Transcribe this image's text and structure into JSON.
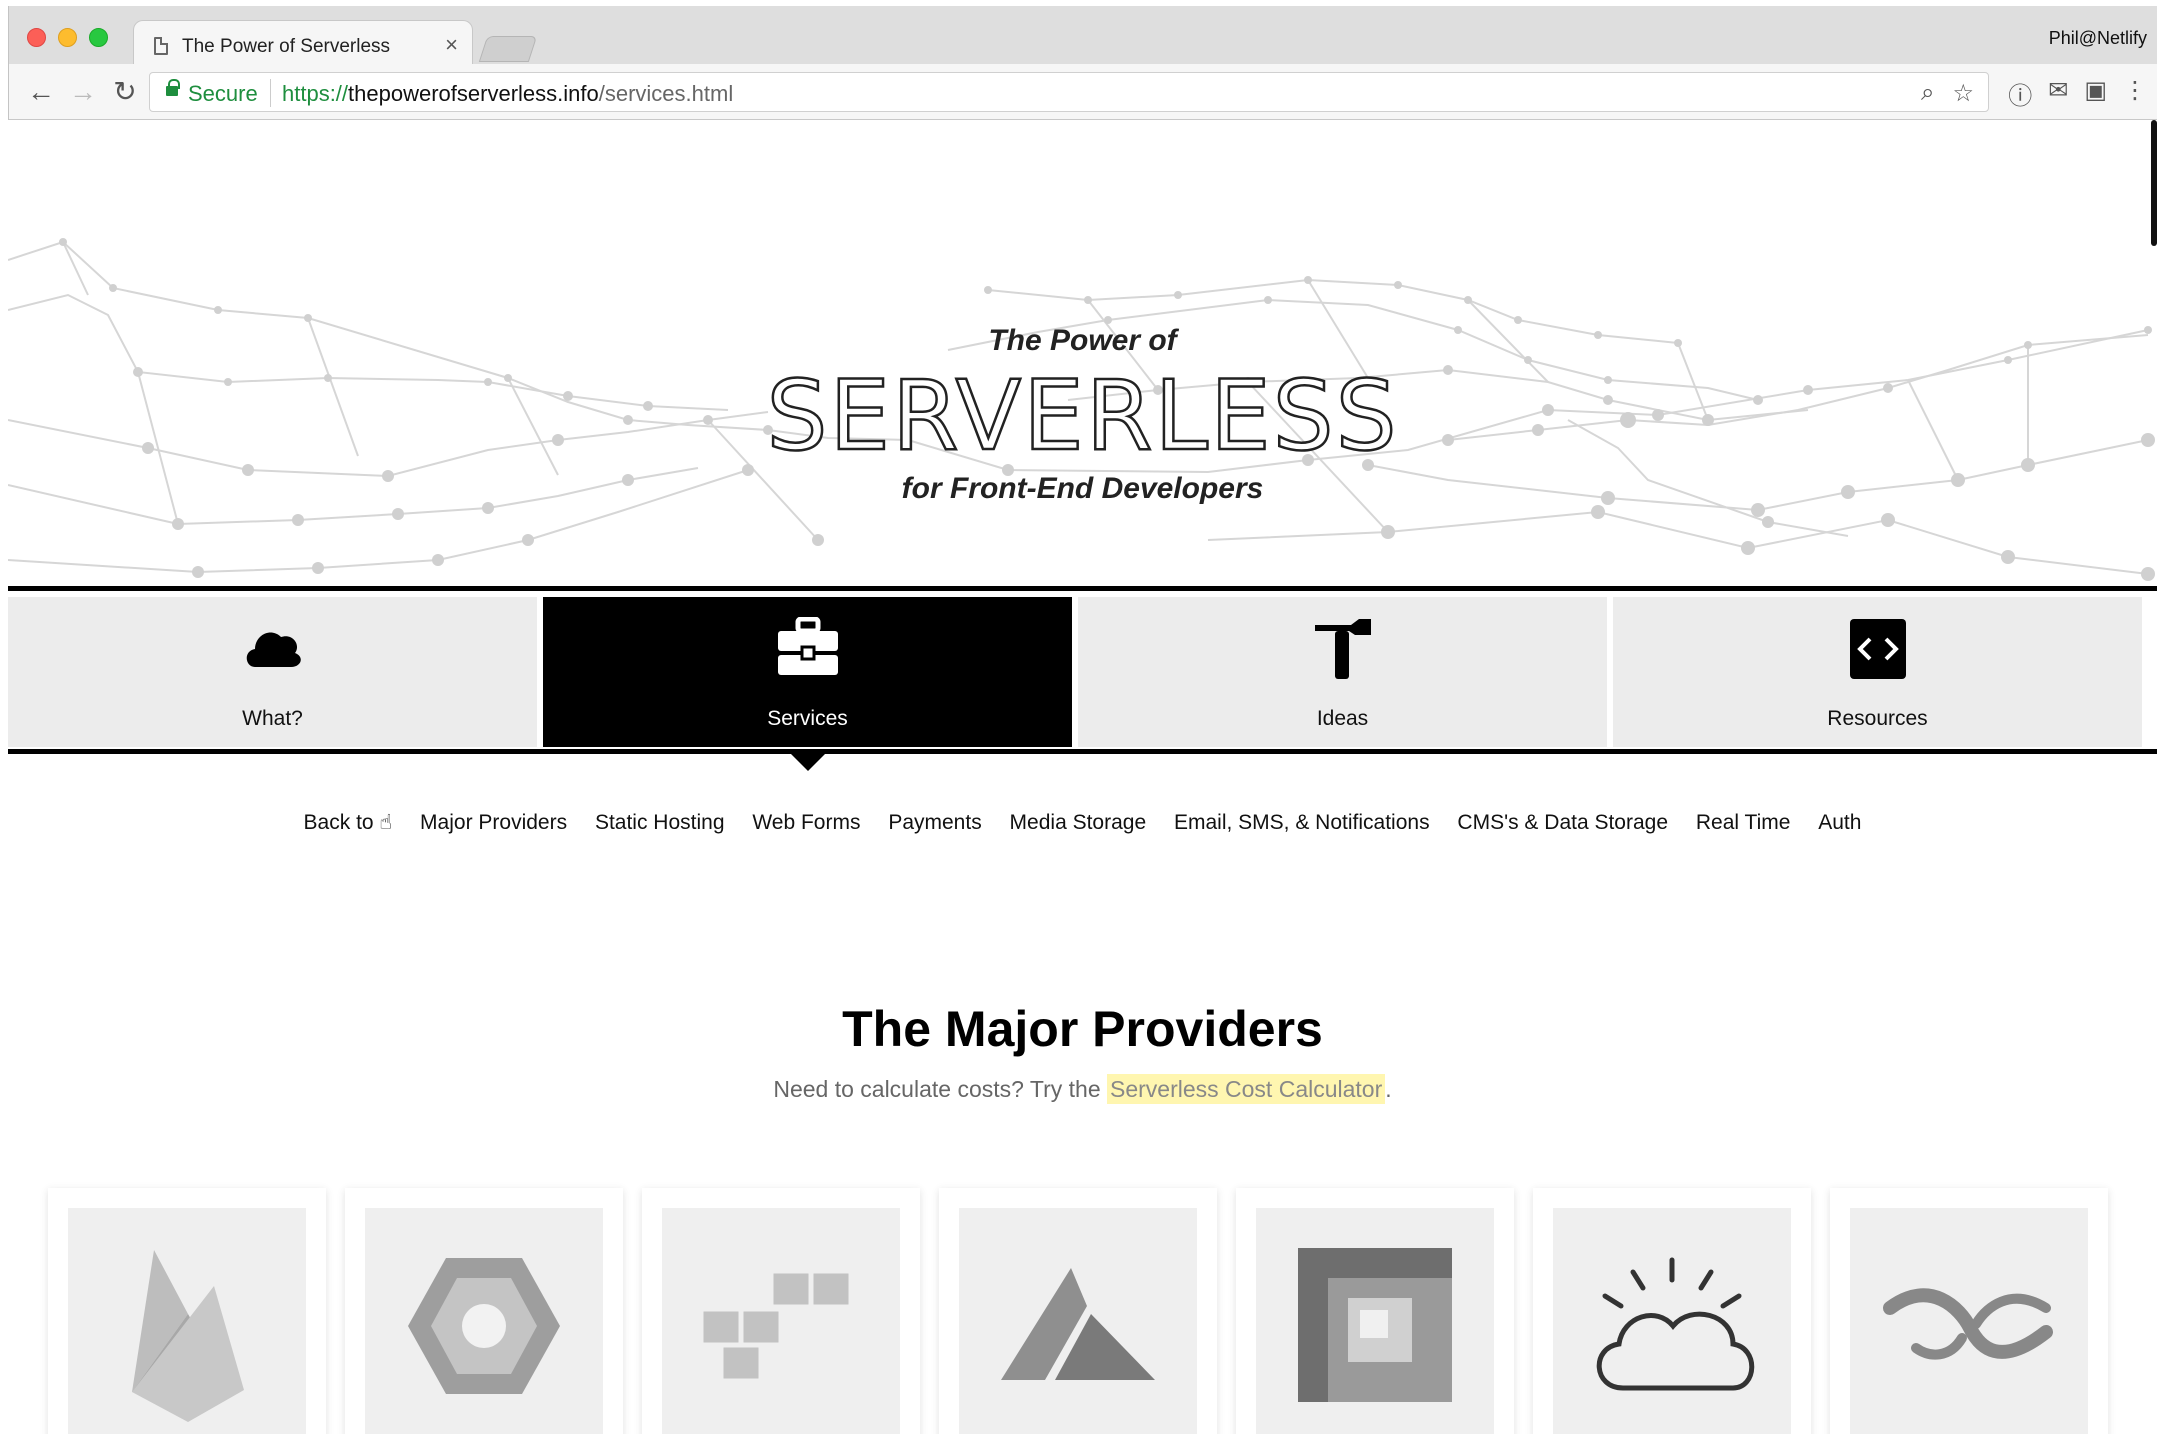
{
  "browser": {
    "tab_title": "The Power of Serverless",
    "tab_close": "×",
    "profile": "Phil@Netlify",
    "secure_label": "Secure",
    "url_scheme": "https://",
    "url_host": "thepowerofserverless.info",
    "url_path": "/services.html",
    "back_icon": "←",
    "forward_icon": "→",
    "reload_icon": "↻",
    "zoom_icon": "⌕",
    "star_icon": "☆",
    "ext_icons": [
      "ⓘ",
      "✉",
      "▣",
      "⋮"
    ]
  },
  "hero": {
    "pre_title": "The Power of",
    "title": "SERVERLESS",
    "subtitle": "for Front-End Developers"
  },
  "nav": {
    "tiles": [
      {
        "label": "What?",
        "icon": "cloud-icon",
        "active": false
      },
      {
        "label": "Services",
        "icon": "briefcase-icon",
        "active": true
      },
      {
        "label": "Ideas",
        "icon": "hammer-icon",
        "active": false
      },
      {
        "label": "Resources",
        "icon": "code-book-icon",
        "active": false
      }
    ]
  },
  "subnav": {
    "back_label": "Back to ☝",
    "items": [
      "Major Providers",
      "Static Hosting",
      "Web Forms",
      "Payments",
      "Media Storage",
      "Email, SMS, & Notifications",
      "CMS's & Data Storage",
      "Real Time",
      "Auth"
    ]
  },
  "section": {
    "title": "The Major Providers",
    "sub_prefix": "Need to calculate costs? Try the ",
    "sub_link": "Serverless Cost Calculator",
    "sub_suffix": "."
  },
  "providers": [
    {
      "icon": "firebase-logo-icon"
    },
    {
      "icon": "google-cloud-logo-icon"
    },
    {
      "icon": "aws-lambda-logo-icon"
    },
    {
      "icon": "azure-logo-icon"
    },
    {
      "icon": "square-logo-icon"
    },
    {
      "icon": "ibm-cloud-logo-icon"
    },
    {
      "icon": "webtask-logo-icon"
    }
  ]
}
